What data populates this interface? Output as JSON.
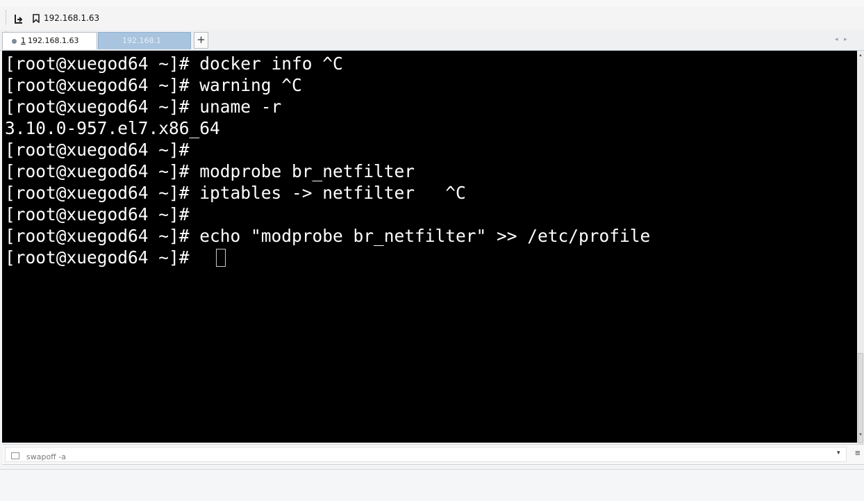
{
  "address_bar": {
    "host": "192.168.1.63"
  },
  "tabs": [
    {
      "index": "1",
      "label": "192.168.1.63",
      "active": true
    },
    {
      "label": "192.168.1",
      "active": false
    }
  ],
  "tab_controls": {
    "add": "+",
    "scroll_left": "◂",
    "scroll_right": "▸"
  },
  "terminal": {
    "lines": [
      "[root@xuegod64 ~]# docker info ^C",
      "[root@xuegod64 ~]# warning ^C",
      "[root@xuegod64 ~]# uname -r",
      "3.10.0-957.el7.x86_64",
      "[root@xuegod64 ~]#",
      "[root@xuegod64 ~]# modprobe br_netfilter",
      "[root@xuegod64 ~]# iptables -> netfilter   ^C",
      "[root@xuegod64 ~]#",
      "[root@xuegod64 ~]# echo \"modprobe br_netfilter\" >> /etc/profile",
      "[root@xuegod64 ~]# "
    ],
    "background": "#000000",
    "foreground": "#ffffff"
  },
  "scrollbar": {
    "up_arrow": "▲",
    "down_arrow": "▼"
  },
  "command_bar": {
    "input_value": "swapoff -a",
    "dropdown_arrow": "▾",
    "menu_glyph": "≡"
  }
}
